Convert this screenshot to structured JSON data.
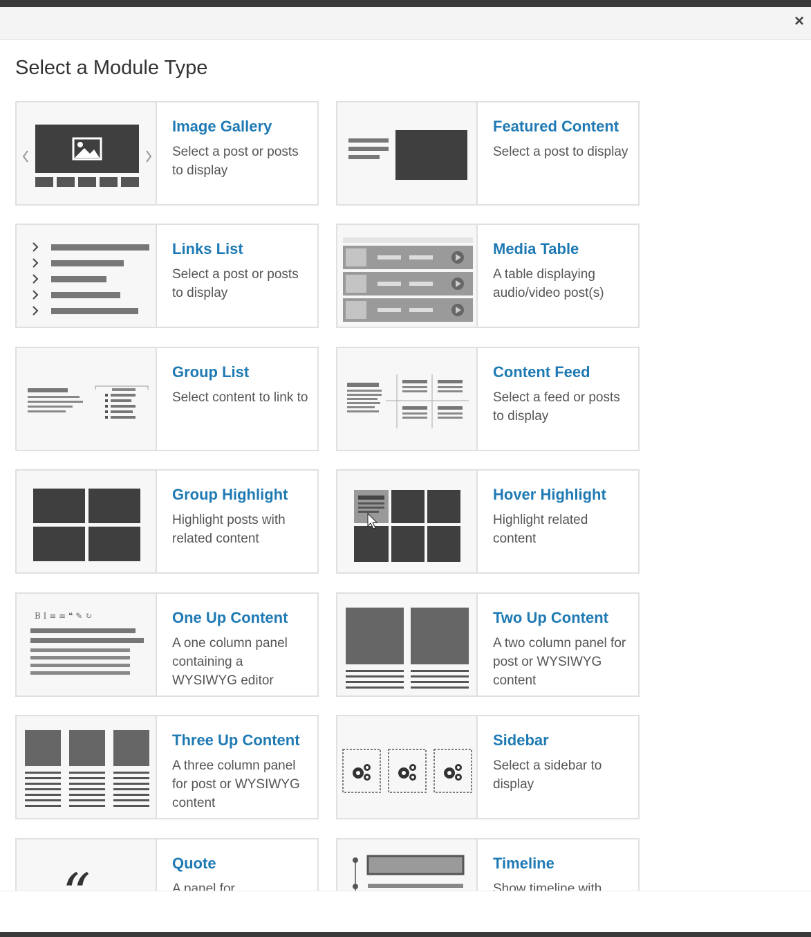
{
  "dialog": {
    "title": "Select a Module Type",
    "close_label": "×"
  },
  "modules": [
    {
      "name": "Image Gallery",
      "desc": "Select a post or posts to display"
    },
    {
      "name": "Featured Content",
      "desc": "Select a post to display"
    },
    {
      "name": "Links List",
      "desc": "Select a post or posts to display"
    },
    {
      "name": "Media Table",
      "desc": "A table displaying audio/video post(s)"
    },
    {
      "name": "Group List",
      "desc": "Select content to link to"
    },
    {
      "name": "Content Feed",
      "desc": "Select a feed or posts to display"
    },
    {
      "name": "Group Highlight",
      "desc": "Highlight posts with related content"
    },
    {
      "name": "Hover Highlight",
      "desc": "Highlight related content"
    },
    {
      "name": "One Up Content",
      "desc": "A one column panel containing a WYSIWYG editor"
    },
    {
      "name": "Two Up Content",
      "desc": "A two column panel for post or WYSIWYG content"
    },
    {
      "name": "Three Up Content",
      "desc": "A three column panel for post or WYSIWYG content"
    },
    {
      "name": "Sidebar",
      "desc": "Select a sidebar to display"
    },
    {
      "name": "Quote",
      "desc": "A panel for"
    },
    {
      "name": "Timeline",
      "desc": "Show timeline with"
    }
  ],
  "colors": {
    "accent": "#1f7ab4",
    "thumb_dark": "#3f3f3f",
    "thumb_mid": "#888888"
  },
  "editor_toolbar_glyphs": "B I ≡ ≡ ❝ ✎ ↻"
}
